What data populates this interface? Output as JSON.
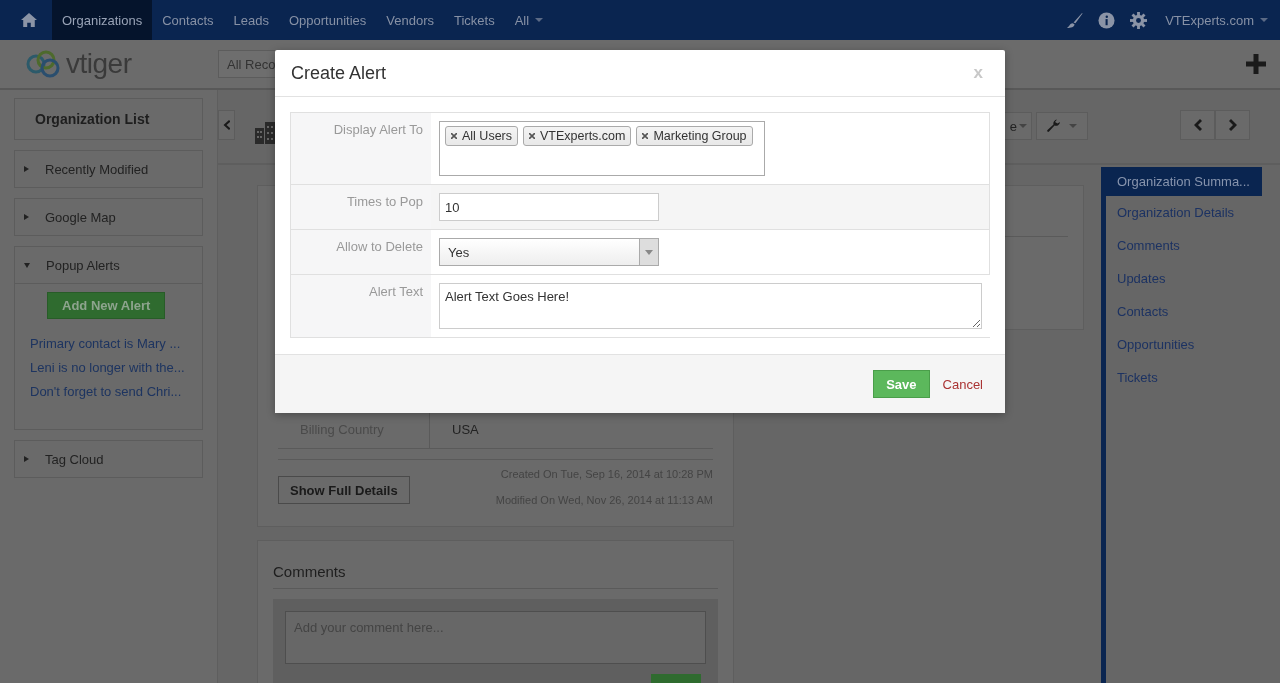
{
  "nav": {
    "items": [
      {
        "label": "Organizations",
        "selected": true,
        "kind": "link"
      },
      {
        "label": "Contacts",
        "selected": false,
        "kind": "link"
      },
      {
        "label": "Leads",
        "selected": false,
        "kind": "link"
      },
      {
        "label": "Opportunities",
        "selected": false,
        "kind": "link"
      },
      {
        "label": "Vendors",
        "selected": false,
        "kind": "link"
      },
      {
        "label": "Tickets",
        "selected": false,
        "kind": "link"
      },
      {
        "label": "All",
        "selected": false,
        "kind": "dropdown"
      }
    ],
    "user": "VTExperts.com"
  },
  "header": {
    "logo": "vtiger",
    "filter": "All Reco"
  },
  "sidebar": {
    "title": "Organization List",
    "widgets": [
      {
        "label": "Recently Modified",
        "expanded": false
      },
      {
        "label": "Google Map",
        "expanded": false
      },
      {
        "label": "Popup Alerts",
        "expanded": true,
        "button": "Add New Alert",
        "alerts": [
          "Primary contact is Mary ...",
          "Leni is no longer with the...",
          "Don't forget to send Chri..."
        ]
      },
      {
        "label": "Tag Cloud",
        "expanded": false
      }
    ]
  },
  "toolbar": {
    "dropdown_label": "e"
  },
  "summary": {
    "rows": [
      {
        "label": "Billing Country",
        "value": "USA"
      }
    ],
    "show_details": "Show Full Details",
    "created": "Created On Tue, Sep 16, 2014 at 10:28 PM",
    "modified": "Modified On Wed, Nov 26, 2014 at 11:13 AM"
  },
  "comments": {
    "title": "Comments",
    "placeholder": "Add your comment here..."
  },
  "related_nav": [
    {
      "label": "Organization Summa...",
      "selected": true
    },
    {
      "label": "Organization Details",
      "selected": false
    },
    {
      "label": "Comments",
      "selected": false
    },
    {
      "label": "Updates",
      "selected": false
    },
    {
      "label": "Contacts",
      "selected": false
    },
    {
      "label": "Opportunities",
      "selected": false
    },
    {
      "label": "Tickets",
      "selected": false
    }
  ],
  "modal": {
    "title": "Create Alert",
    "close": "x",
    "fields": [
      {
        "kind": "tags",
        "label": "Display Alert To",
        "tags": [
          "All Users",
          "VTExperts.com",
          "Marketing Group"
        ]
      },
      {
        "kind": "text",
        "label": "Times to Pop",
        "value": "10"
      },
      {
        "kind": "select",
        "label": "Allow to Delete",
        "value": "Yes"
      },
      {
        "kind": "textarea",
        "label": "Alert Text",
        "value": "Alert Text Goes Here!"
      }
    ],
    "save": "Save",
    "cancel": "Cancel"
  }
}
